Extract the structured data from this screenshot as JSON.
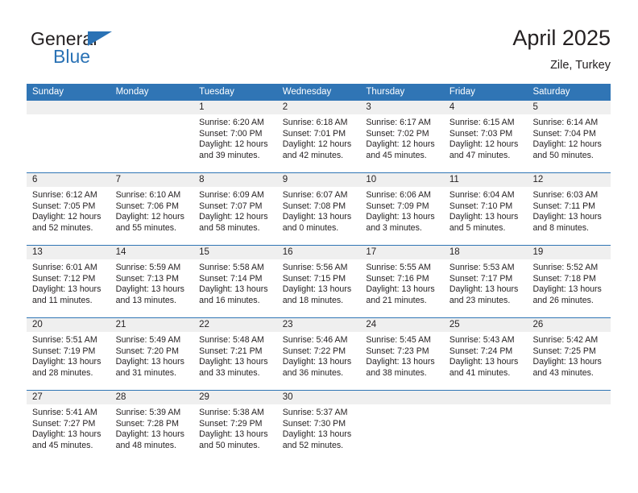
{
  "brand": {
    "name_part1": "General",
    "name_part2": "Blue",
    "triangle_icon": "brand-triangle-icon",
    "colors": {
      "blue": "#2a72b5",
      "dark": "#231f20"
    }
  },
  "header": {
    "month_title": "April 2025",
    "location": "Zile, Turkey"
  },
  "calendar": {
    "header_color": "#3075b5",
    "daynum_band_color": "#efefef",
    "weekdays": [
      "Sunday",
      "Monday",
      "Tuesday",
      "Wednesday",
      "Thursday",
      "Friday",
      "Saturday"
    ],
    "weeks": [
      [
        {
          "day": "",
          "lines": []
        },
        {
          "day": "",
          "lines": []
        },
        {
          "day": "1",
          "lines": [
            "Sunrise: 6:20 AM",
            "Sunset: 7:00 PM",
            "Daylight: 12 hours",
            "and 39 minutes."
          ]
        },
        {
          "day": "2",
          "lines": [
            "Sunrise: 6:18 AM",
            "Sunset: 7:01 PM",
            "Daylight: 12 hours",
            "and 42 minutes."
          ]
        },
        {
          "day": "3",
          "lines": [
            "Sunrise: 6:17 AM",
            "Sunset: 7:02 PM",
            "Daylight: 12 hours",
            "and 45 minutes."
          ]
        },
        {
          "day": "4",
          "lines": [
            "Sunrise: 6:15 AM",
            "Sunset: 7:03 PM",
            "Daylight: 12 hours",
            "and 47 minutes."
          ]
        },
        {
          "day": "5",
          "lines": [
            "Sunrise: 6:14 AM",
            "Sunset: 7:04 PM",
            "Daylight: 12 hours",
            "and 50 minutes."
          ]
        }
      ],
      [
        {
          "day": "6",
          "lines": [
            "Sunrise: 6:12 AM",
            "Sunset: 7:05 PM",
            "Daylight: 12 hours",
            "and 52 minutes."
          ]
        },
        {
          "day": "7",
          "lines": [
            "Sunrise: 6:10 AM",
            "Sunset: 7:06 PM",
            "Daylight: 12 hours",
            "and 55 minutes."
          ]
        },
        {
          "day": "8",
          "lines": [
            "Sunrise: 6:09 AM",
            "Sunset: 7:07 PM",
            "Daylight: 12 hours",
            "and 58 minutes."
          ]
        },
        {
          "day": "9",
          "lines": [
            "Sunrise: 6:07 AM",
            "Sunset: 7:08 PM",
            "Daylight: 13 hours",
            "and 0 minutes."
          ]
        },
        {
          "day": "10",
          "lines": [
            "Sunrise: 6:06 AM",
            "Sunset: 7:09 PM",
            "Daylight: 13 hours",
            "and 3 minutes."
          ]
        },
        {
          "day": "11",
          "lines": [
            "Sunrise: 6:04 AM",
            "Sunset: 7:10 PM",
            "Daylight: 13 hours",
            "and 5 minutes."
          ]
        },
        {
          "day": "12",
          "lines": [
            "Sunrise: 6:03 AM",
            "Sunset: 7:11 PM",
            "Daylight: 13 hours",
            "and 8 minutes."
          ]
        }
      ],
      [
        {
          "day": "13",
          "lines": [
            "Sunrise: 6:01 AM",
            "Sunset: 7:12 PM",
            "Daylight: 13 hours",
            "and 11 minutes."
          ]
        },
        {
          "day": "14",
          "lines": [
            "Sunrise: 5:59 AM",
            "Sunset: 7:13 PM",
            "Daylight: 13 hours",
            "and 13 minutes."
          ]
        },
        {
          "day": "15",
          "lines": [
            "Sunrise: 5:58 AM",
            "Sunset: 7:14 PM",
            "Daylight: 13 hours",
            "and 16 minutes."
          ]
        },
        {
          "day": "16",
          "lines": [
            "Sunrise: 5:56 AM",
            "Sunset: 7:15 PM",
            "Daylight: 13 hours",
            "and 18 minutes."
          ]
        },
        {
          "day": "17",
          "lines": [
            "Sunrise: 5:55 AM",
            "Sunset: 7:16 PM",
            "Daylight: 13 hours",
            "and 21 minutes."
          ]
        },
        {
          "day": "18",
          "lines": [
            "Sunrise: 5:53 AM",
            "Sunset: 7:17 PM",
            "Daylight: 13 hours",
            "and 23 minutes."
          ]
        },
        {
          "day": "19",
          "lines": [
            "Sunrise: 5:52 AM",
            "Sunset: 7:18 PM",
            "Daylight: 13 hours",
            "and 26 minutes."
          ]
        }
      ],
      [
        {
          "day": "20",
          "lines": [
            "Sunrise: 5:51 AM",
            "Sunset: 7:19 PM",
            "Daylight: 13 hours",
            "and 28 minutes."
          ]
        },
        {
          "day": "21",
          "lines": [
            "Sunrise: 5:49 AM",
            "Sunset: 7:20 PM",
            "Daylight: 13 hours",
            "and 31 minutes."
          ]
        },
        {
          "day": "22",
          "lines": [
            "Sunrise: 5:48 AM",
            "Sunset: 7:21 PM",
            "Daylight: 13 hours",
            "and 33 minutes."
          ]
        },
        {
          "day": "23",
          "lines": [
            "Sunrise: 5:46 AM",
            "Sunset: 7:22 PM",
            "Daylight: 13 hours",
            "and 36 minutes."
          ]
        },
        {
          "day": "24",
          "lines": [
            "Sunrise: 5:45 AM",
            "Sunset: 7:23 PM",
            "Daylight: 13 hours",
            "and 38 minutes."
          ]
        },
        {
          "day": "25",
          "lines": [
            "Sunrise: 5:43 AM",
            "Sunset: 7:24 PM",
            "Daylight: 13 hours",
            "and 41 minutes."
          ]
        },
        {
          "day": "26",
          "lines": [
            "Sunrise: 5:42 AM",
            "Sunset: 7:25 PM",
            "Daylight: 13 hours",
            "and 43 minutes."
          ]
        }
      ],
      [
        {
          "day": "27",
          "lines": [
            "Sunrise: 5:41 AM",
            "Sunset: 7:27 PM",
            "Daylight: 13 hours",
            "and 45 minutes."
          ]
        },
        {
          "day": "28",
          "lines": [
            "Sunrise: 5:39 AM",
            "Sunset: 7:28 PM",
            "Daylight: 13 hours",
            "and 48 minutes."
          ]
        },
        {
          "day": "29",
          "lines": [
            "Sunrise: 5:38 AM",
            "Sunset: 7:29 PM",
            "Daylight: 13 hours",
            "and 50 minutes."
          ]
        },
        {
          "day": "30",
          "lines": [
            "Sunrise: 5:37 AM",
            "Sunset: 7:30 PM",
            "Daylight: 13 hours",
            "and 52 minutes."
          ]
        },
        {
          "day": "",
          "lines": []
        },
        {
          "day": "",
          "lines": []
        },
        {
          "day": "",
          "lines": []
        }
      ]
    ]
  }
}
